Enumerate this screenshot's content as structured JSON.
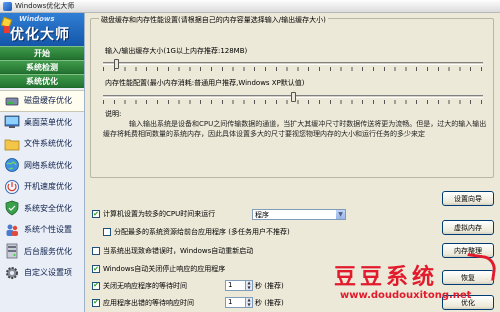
{
  "window": {
    "title": "Windows优化大师"
  },
  "logo": {
    "small": "Windows",
    "big": "优化大师"
  },
  "sidebar": {
    "sections": [
      "开始",
      "系统检测",
      "系统优化"
    ],
    "items": [
      {
        "label": "磁盘缓存优化",
        "icon": "disk-icon"
      },
      {
        "label": "桌面菜单优化",
        "icon": "desktop-icon"
      },
      {
        "label": "文件系统优化",
        "icon": "folder-icon"
      },
      {
        "label": "网络系统优化",
        "icon": "globe-icon"
      },
      {
        "label": "开机速度优化",
        "icon": "power-icon"
      },
      {
        "label": "系统安全优化",
        "icon": "shield-icon"
      },
      {
        "label": "系统个性设置",
        "icon": "users-icon"
      },
      {
        "label": "后台服务优化",
        "icon": "server-icon"
      },
      {
        "label": "自定义设置项",
        "icon": "gear-icon"
      }
    ]
  },
  "group": {
    "title": "磁盘缓存和内存性能设置(请根据自己的内存容量选择输入/输出缓存大小)",
    "io_cache_label": "输入/输出缓存大小(1G以上内存推荐:128MB)",
    "io_cache_level": 0.03,
    "mem_perf_label": "内存性能配置(最小内存消耗:普通用户推荐,Windows XP默认值)",
    "mem_perf_level": 0.5,
    "desc_title": "说明:",
    "desc_text": "输入输出系统是设备和CPU之间传输数据的通道，当扩大其缓冲尺寸时数据传送将更为流畅。但是，过大的输入输出缓存将耗费相同数量的系统内存，因此具体设置多大的尺寸要视您物理内存的大小和运行任务的多少来定"
  },
  "options": {
    "cpu_wait": {
      "label": "计算机设置为较多的CPU时间来运行",
      "checked": true,
      "select": "程序"
    },
    "separate_process": {
      "label": "分配最多的系统资源给前台应用程序 (多任务用户不推荐)",
      "checked": false
    },
    "auto_restart": {
      "label": "当系统出现致命错误时，Windows自动重新启动",
      "checked": false
    },
    "auto_close": {
      "label": "Windows自动关闭停止响应的应用程序",
      "checked": true
    },
    "close_wait": {
      "label": "关闭无响应程序的等待时间",
      "checked": true,
      "value": "1",
      "unit": "秒 (推荐)"
    },
    "error_wait": {
      "label": "应用程序出错的等待响应时间",
      "checked": true,
      "value": "1",
      "unit": "秒 (推荐)"
    }
  },
  "buttons": {
    "wizard": "设置向导",
    "vmem": "虚拟内存",
    "mem_clean": "内存整理",
    "restore": "恢复",
    "optimize": "优化"
  },
  "watermark": {
    "text": "豆豆系统",
    "url": "www.doudouxitong.net"
  },
  "colors": {
    "accent_green": "#237331",
    "watermark_red": "#e11b2c",
    "logo_blue": "#1556a9"
  }
}
